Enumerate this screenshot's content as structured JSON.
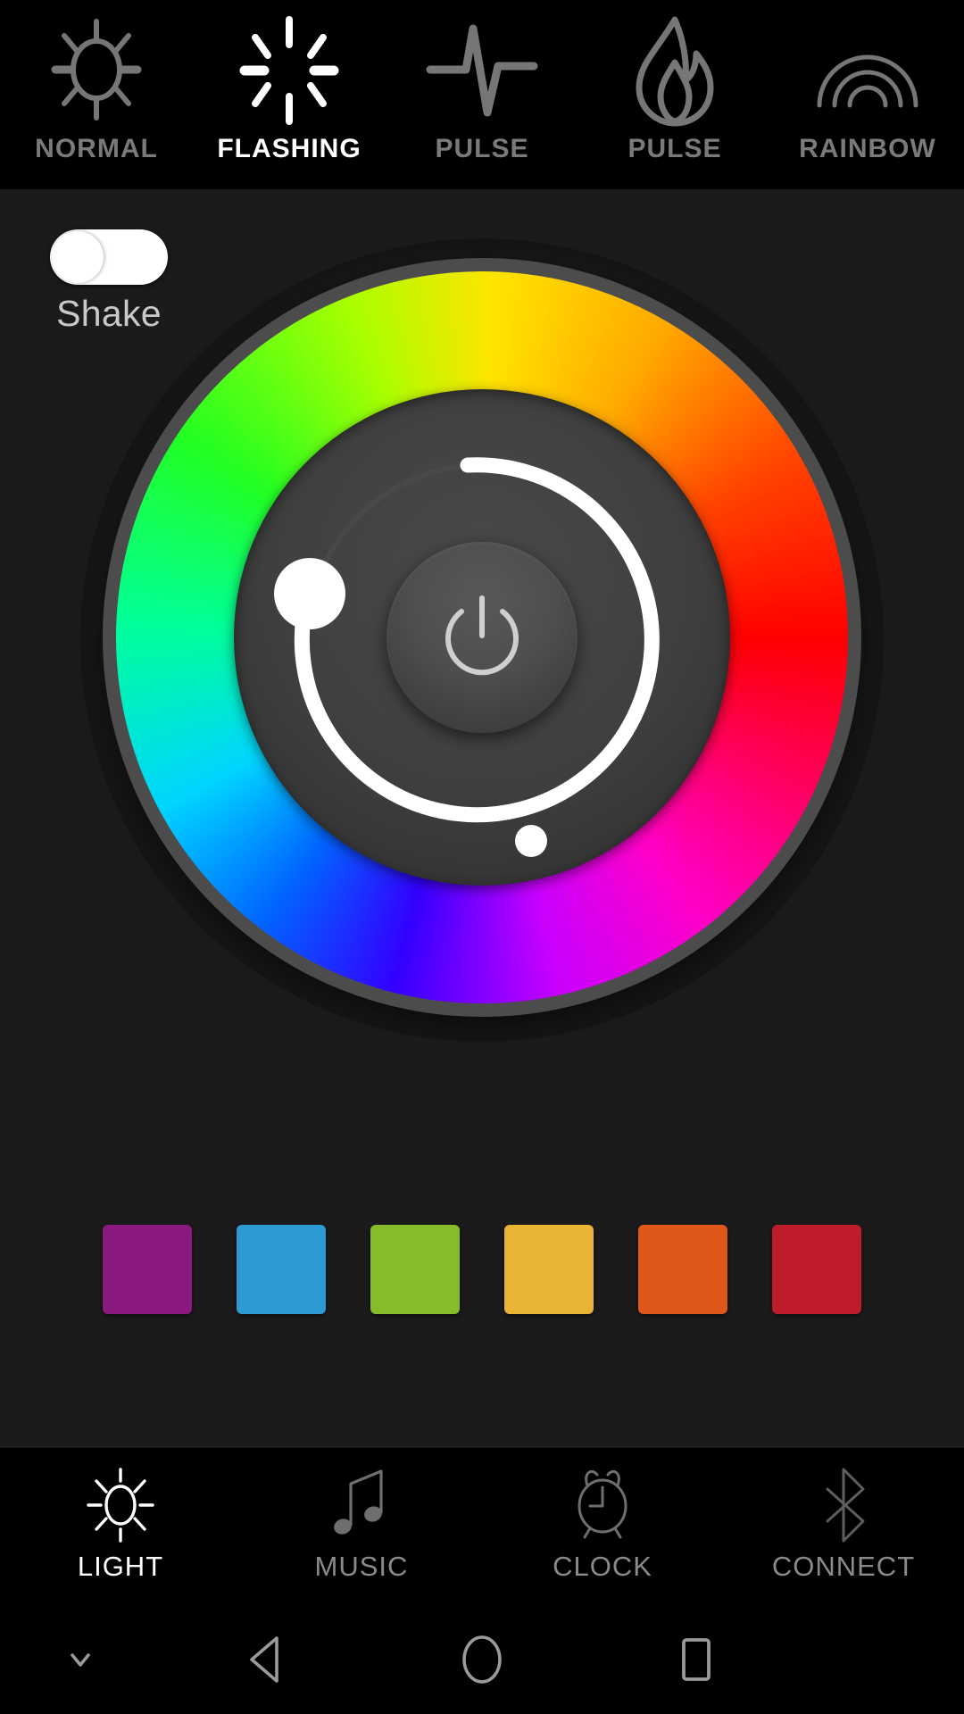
{
  "app": {
    "screen_background": "#000000",
    "panel_background": "#1b1b1b",
    "accent_white": "#ffffff",
    "inactive_grey": "#7a7a7a"
  },
  "mode_bar": {
    "items": [
      {
        "label": "NORMAL",
        "icon": "sun-icon",
        "active": false
      },
      {
        "label": "FLASHING",
        "icon": "flash-rays-icon",
        "active": true
      },
      {
        "label": "PULSE",
        "icon": "heartbeat-icon",
        "active": false
      },
      {
        "label": "PULSE",
        "icon": "flame-icon",
        "active": false
      },
      {
        "label": "RAINBOW",
        "icon": "rainbow-icon",
        "active": false
      }
    ]
  },
  "shake": {
    "label": "Shake",
    "state": "off",
    "track_color": "#ffffff"
  },
  "color_wheel": {
    "name": "hue-ring",
    "brightness_arc_color": "#ffffff",
    "brightness_handle": "brightness-handle",
    "hue_marker": "hue-marker",
    "power_button_label": "power-icon"
  },
  "swatches": [
    {
      "name": "swatch-magenta",
      "color": "#8a1980"
    },
    {
      "name": "swatch-blue",
      "color": "#2e9ad3"
    },
    {
      "name": "swatch-green",
      "color": "#86bc2a"
    },
    {
      "name": "swatch-yellow",
      "color": "#e9b335"
    },
    {
      "name": "swatch-orange",
      "color": "#df5719"
    },
    {
      "name": "swatch-red",
      "color": "#be1c2b"
    }
  ],
  "bottom_nav": {
    "items": [
      {
        "label": "LIGHT",
        "icon": "sun-icon",
        "active": true
      },
      {
        "label": "MUSIC",
        "icon": "music-note-icon",
        "active": false
      },
      {
        "label": "CLOCK",
        "icon": "alarm-clock-icon",
        "active": false
      },
      {
        "label": "CONNECT",
        "icon": "bluetooth-icon",
        "active": false
      }
    ]
  },
  "system_bar": {
    "hide_keyboard": "chevron-down-icon",
    "back": "back-triangle-icon",
    "home": "home-circle-icon",
    "recents": "recents-square-icon"
  }
}
